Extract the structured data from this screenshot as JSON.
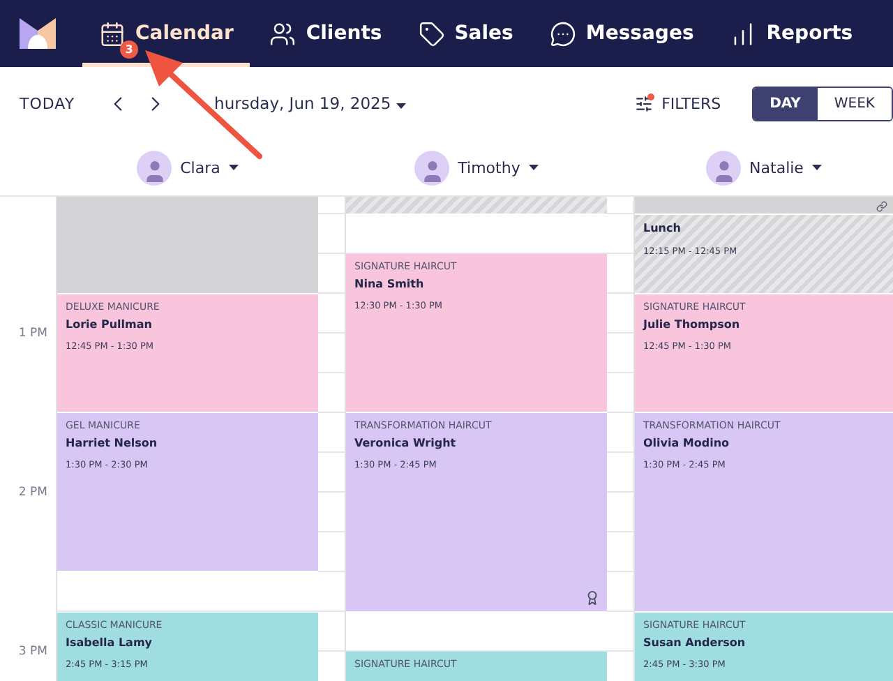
{
  "nav": {
    "tabs": [
      {
        "label": "Calendar",
        "selected": true,
        "badge": "3"
      },
      {
        "label": "Clients",
        "selected": false
      },
      {
        "label": "Sales",
        "selected": false
      },
      {
        "label": "Messages",
        "selected": false
      },
      {
        "label": "Reports",
        "selected": false
      }
    ]
  },
  "toolbar": {
    "today": "TODAY",
    "date": "hursday, Jun 19, 2025",
    "filters": {
      "label": "FILTERS",
      "active": true
    },
    "views": [
      {
        "label": "DAY",
        "selected": true
      },
      {
        "label": "WEEK",
        "selected": false
      }
    ]
  },
  "staff": [
    {
      "name": "Clara"
    },
    {
      "name": "Timothy"
    },
    {
      "name": "Natalie"
    }
  ],
  "time_labels": [
    "1 PM",
    "2 PM",
    "3 PM"
  ],
  "columns": [
    {
      "events": [
        {
          "kind": "blocked"
        },
        {
          "kind": "appointment",
          "service": "DELUXE MANICURE",
          "client": "Lorie Pullman",
          "time": "12:45 PM - 1:30 PM",
          "color": "#f9c5dc",
          "award": false
        },
        {
          "kind": "appointment",
          "service": "GEL MANICURE",
          "client": "Harriet Nelson",
          "time": "1:30 PM - 2:30 PM",
          "color": "#d8c6f4",
          "award": false
        },
        {
          "kind": "appointment",
          "service": "CLASSIC MANICURE",
          "client": "Isabella Lamy",
          "time": "2:45 PM - 3:15 PM",
          "color": "#9fdde0",
          "award": false
        }
      ]
    },
    {
      "events": [
        {
          "kind": "break"
        },
        {
          "kind": "appointment",
          "service": "SIGNATURE HAIRCUT",
          "client": "Nina Smith",
          "time": "12:30 PM - 1:30 PM",
          "color": "#f9c5dc",
          "award": false
        },
        {
          "kind": "appointment",
          "service": "TRANSFORMATION HAIRCUT",
          "client": "Veronica Wright",
          "time": "1:30 PM - 2:45 PM",
          "color": "#d8c6f4",
          "award": true
        },
        {
          "kind": "appointment",
          "service": "SIGNATURE HAIRCUT",
          "color": "#9fdde0",
          "award": false
        }
      ]
    },
    {
      "events": [
        {
          "kind": "blocked",
          "linked": true
        },
        {
          "kind": "break",
          "title": "Lunch",
          "time": "12:15 PM - 12:45 PM"
        },
        {
          "kind": "appointment",
          "service": "SIGNATURE HAIRCUT",
          "client": "Julie Thompson",
          "time": "12:45 PM - 1:30 PM",
          "color": "#f9c5dc",
          "award": false
        },
        {
          "kind": "appointment",
          "service": "TRANSFORMATION HAIRCUT",
          "client": "Olivia Modino",
          "time": "1:30 PM - 2:45 PM",
          "color": "#d8c6f4",
          "award": false
        },
        {
          "kind": "appointment",
          "service": "SIGNATURE HAIRCUT",
          "client": "Susan Anderson",
          "time": "2:45 PM - 3:30 PM",
          "color": "#9fdde0",
          "award": false
        }
      ]
    }
  ]
}
